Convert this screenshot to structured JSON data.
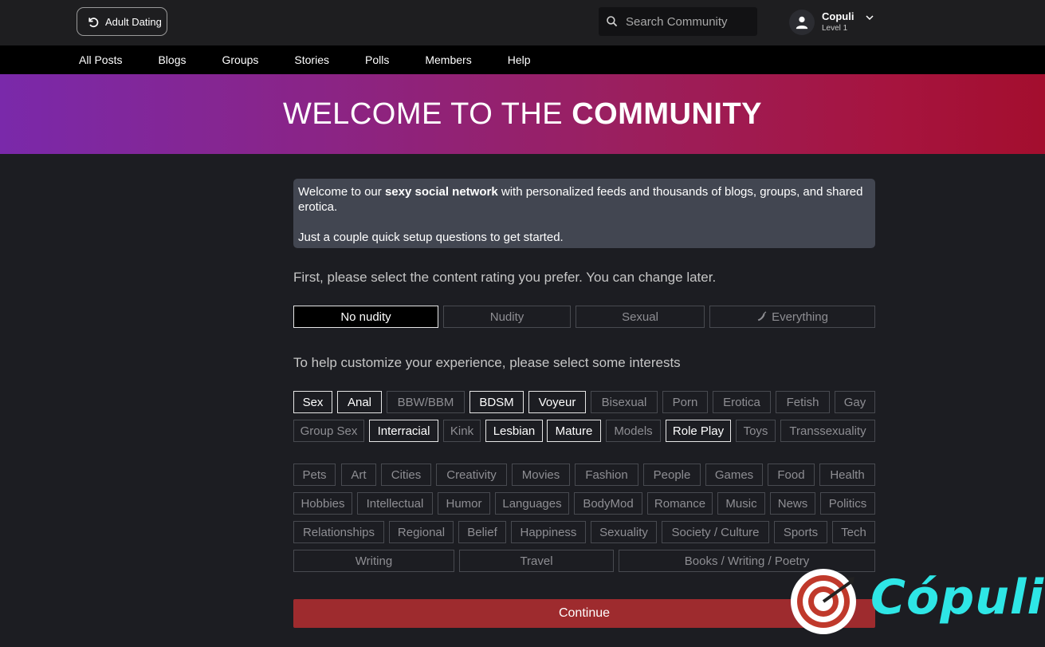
{
  "header": {
    "switch_label": "Adult Dating",
    "search_placeholder": "Search Community",
    "user_name": "Copuli",
    "user_level": "Level 1"
  },
  "nav": [
    "All Posts",
    "Blogs",
    "Groups",
    "Stories",
    "Polls",
    "Members",
    "Help"
  ],
  "hero": {
    "title_light": "WELCOME TO THE ",
    "title_bold": "COMMUNITY"
  },
  "intro": {
    "line1_pre": "Welcome to our ",
    "line1_bold": "sexy social network",
    "line1_post": " with personalized feeds and thousands of blogs, groups, and shared erotica.",
    "line2": "Just a couple quick setup questions to get started."
  },
  "rating_prompt": "First, please select the content rating you prefer. You can change later.",
  "ratings": [
    {
      "label": "No nudity",
      "selected": true
    },
    {
      "label": "Nudity",
      "selected": false
    },
    {
      "label": "Sexual",
      "selected": false
    },
    {
      "label": "Everything",
      "selected": false,
      "icon": "pepper-icon"
    }
  ],
  "interests_prompt": "To help customize your experience, please select some interests",
  "adult_interests": [
    {
      "label": "Sex",
      "selected": true
    },
    {
      "label": "Anal",
      "selected": true
    },
    {
      "label": "BBW/BBM",
      "selected": false
    },
    {
      "label": "BDSM",
      "selected": true
    },
    {
      "label": "Voyeur",
      "selected": true
    },
    {
      "label": "Bisexual",
      "selected": false
    },
    {
      "label": "Porn",
      "selected": false
    },
    {
      "label": "Erotica",
      "selected": false
    },
    {
      "label": "Fetish",
      "selected": false
    },
    {
      "label": "Gay",
      "selected": false
    },
    {
      "label": "Group Sex",
      "selected": false
    },
    {
      "label": "Interracial",
      "selected": true
    },
    {
      "label": "Kink",
      "selected": false
    },
    {
      "label": "Lesbian",
      "selected": true
    },
    {
      "label": "Mature",
      "selected": true
    },
    {
      "label": "Models",
      "selected": false
    },
    {
      "label": "Role Play",
      "selected": true
    },
    {
      "label": "Toys",
      "selected": false
    },
    {
      "label": "Transsexuality",
      "selected": false
    }
  ],
  "general_interests": [
    "Pets",
    "Art",
    "Cities",
    "Creativity",
    "Movies",
    "Fashion",
    "People",
    "Games",
    "Food",
    "Health",
    "Hobbies",
    "Intellectual",
    "Humor",
    "Languages",
    "BodyMod",
    "Romance",
    "Music",
    "News",
    "Politics",
    "Relationships",
    "Regional",
    "Belief",
    "Happiness",
    "Sexuality",
    "Society / Culture",
    "Sports",
    "Tech",
    "Writing",
    "Travel",
    "Books / Writing / Poetry"
  ],
  "continue_label": "Continue",
  "logo_text": "Cópuli",
  "colors": {
    "accent": "#9e2b2e",
    "hero_start": "#7a29aa",
    "hero_end": "#a30e2e",
    "logo": "#2ee6e6"
  }
}
